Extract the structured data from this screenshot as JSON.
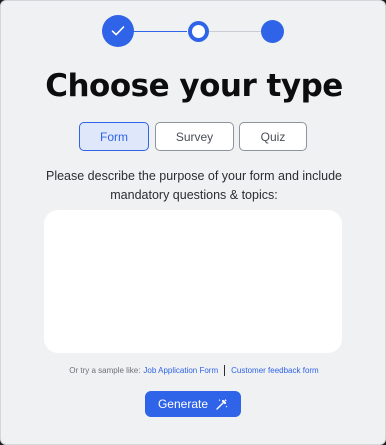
{
  "stepper": {
    "steps": [
      {
        "state": "completed",
        "icon": "check-icon"
      },
      {
        "state": "current"
      },
      {
        "state": "upcoming"
      }
    ],
    "accent_color": "#2f63e8"
  },
  "title": "Choose your type",
  "type_options": [
    {
      "label": "Form",
      "selected": true
    },
    {
      "label": "Survey",
      "selected": false
    },
    {
      "label": "Quiz",
      "selected": false
    }
  ],
  "prompt": "Please describe the purpose of your form and include mandatory questions & topics:",
  "description": {
    "value": "",
    "placeholder": ""
  },
  "samples": {
    "lead": "Or try a sample like:",
    "links": [
      "Job Application Form",
      "Customer feedback form"
    ]
  },
  "generate": {
    "label": "Generate",
    "icon": "magic-wand-icon"
  }
}
